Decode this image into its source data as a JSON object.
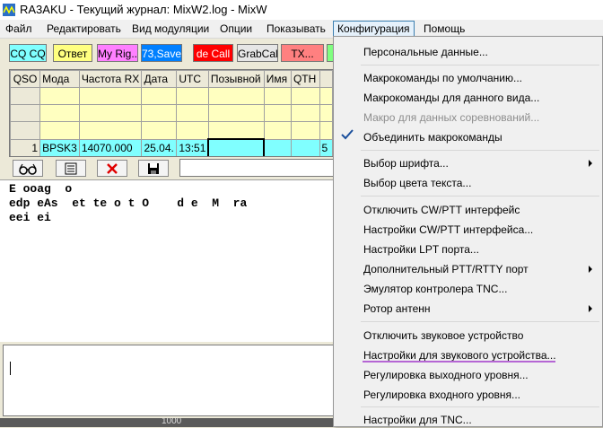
{
  "window": {
    "title": "RA3AKU - Текущий журнал: MixW2.log - MixW"
  },
  "menubar": {
    "items": [
      "Файл",
      "Редактировать",
      "Вид модуляции",
      "Опции",
      "Показывать",
      "Конфигурация",
      "Помощь"
    ],
    "open_item": "Конфигурация"
  },
  "toolbar": {
    "buttons": [
      {
        "label": "CQ CQ",
        "bg": "#80ffff"
      },
      {
        "label": "Ответ",
        "bg": "#ffff80"
      },
      {
        "label": "My Rig..",
        "bg": "#ff80ff"
      },
      {
        "label": "73,Save",
        "bg": "#0080ff",
        "fg": "#ffffff"
      },
      {
        "label": "de Call",
        "bg": "#ff0000",
        "fg": "#ffffff"
      },
      {
        "label": "GrabCall",
        "bg": "#e6e6e6"
      },
      {
        "label": "TX...",
        "bg": "#ff8080"
      }
    ]
  },
  "log_table": {
    "columns": [
      "QSO",
      "Мода",
      "Частота RX",
      "Дата",
      "UTC",
      "Позывной",
      "Имя",
      "QTH",
      ""
    ],
    "current_row": {
      "qso": "1",
      "mode": "BPSK3",
      "freq": "14070.000",
      "date": "25.04.",
      "utc": "13:51",
      "call": "",
      "name": "",
      "qth": "",
      "extra": "5"
    }
  },
  "icons": {
    "glasses": "glasses-icon",
    "notes": "notes-icon",
    "delete": "delete-icon",
    "save": "save-icon"
  },
  "rx_window": {
    "lines": [
      "E ooag  o",
      "edp eAs  et te o t O    d e  M  ra",
      "eei ei"
    ]
  },
  "statusbar": {
    "text": "1000"
  },
  "dropdown": {
    "items": [
      {
        "label": "Персональные данные..."
      },
      {
        "label": "Макрокоманды по умолчанию..."
      },
      {
        "label": "Макрокоманды для данного вида..."
      },
      {
        "label": "Макро для данных соревнований...",
        "disabled": true
      },
      {
        "label": "Объединить макрокоманды",
        "checked": true
      },
      {
        "label": "Выбор шрифта..."
      },
      {
        "label": "Выбор цвета текста..."
      },
      {
        "label": "Отключить CW/PTT интерфейс"
      },
      {
        "label": "Настройки CW/PTT интерфейса..."
      },
      {
        "label": "Настройки LPT порта..."
      },
      {
        "label": "Дополнительный PTT/RTTY порт"
      },
      {
        "label": "Эмулятор контролера TNC..."
      },
      {
        "label": "Ротор антенн"
      },
      {
        "label": "Отключить звуковое устройство"
      },
      {
        "label": "Настройки для звукового устройства..."
      },
      {
        "label": "Регулировка выходного уровня..."
      },
      {
        "label": "Регулировка входного уровня..."
      },
      {
        "label": "Настройки для TNC..."
      }
    ]
  }
}
